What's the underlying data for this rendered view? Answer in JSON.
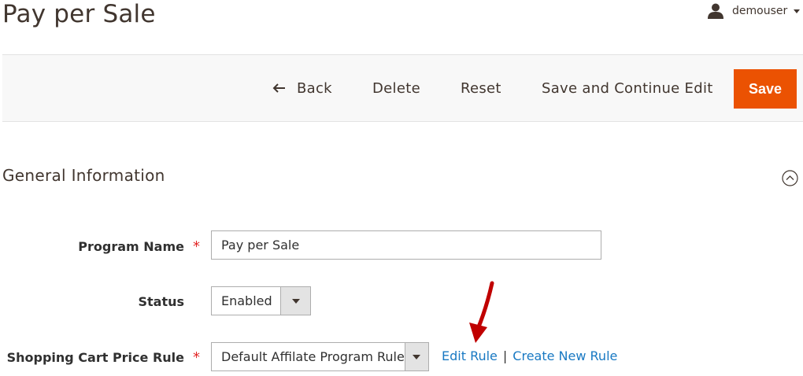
{
  "header": {
    "page_title": "Pay per Sale",
    "username": "demouser"
  },
  "toolbar": {
    "back_label": "Back",
    "delete_label": "Delete",
    "reset_label": "Reset",
    "save_continue_label": "Save and Continue Edit",
    "save_label": "Save"
  },
  "section": {
    "title": "General Information"
  },
  "form": {
    "program_name": {
      "label": "Program Name",
      "value": "Pay per Sale",
      "required": true
    },
    "status": {
      "label": "Status",
      "value": "Enabled",
      "required": false
    },
    "price_rule": {
      "label": "Shopping Cart Price Rule",
      "value": "Default Affilate Program Rule",
      "required": true
    },
    "required_marker": "*"
  },
  "rule_links": {
    "edit": "Edit Rule",
    "separator": "|",
    "create": "Create New Rule"
  },
  "colors": {
    "accent": "#eb5202",
    "link": "#1979c3",
    "required": "#e22626",
    "annotation_arrow": "#c00000"
  },
  "icons": {
    "user": "user-icon",
    "back": "arrow-left-icon",
    "collapse": "collapse-up-icon",
    "dropdown": "caret-down-icon"
  }
}
